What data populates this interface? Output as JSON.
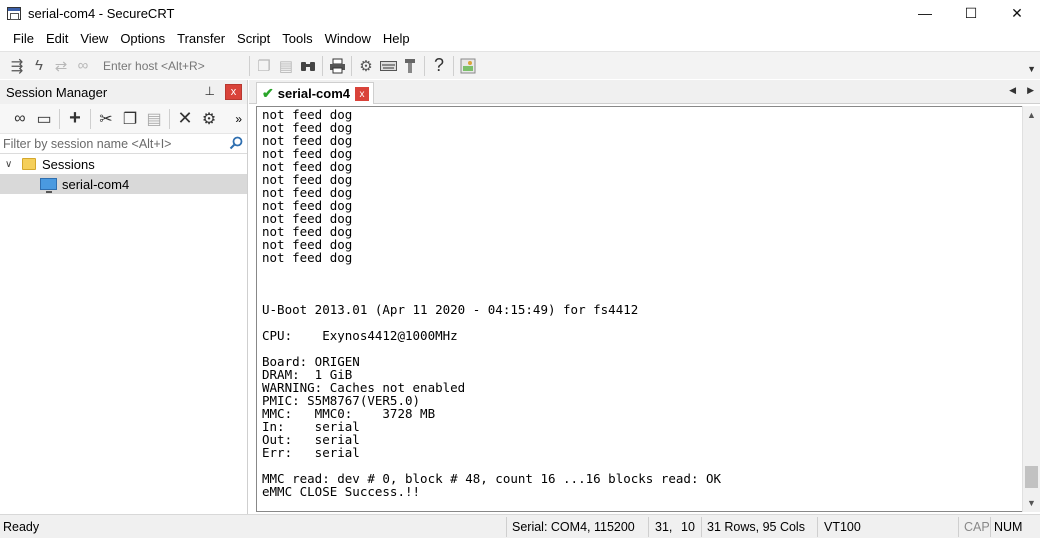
{
  "window": {
    "title": "serial-com4 - SecureCRT",
    "minimize": "—",
    "maximize": "☐",
    "close": "✕"
  },
  "menu": [
    "File",
    "Edit",
    "View",
    "Options",
    "Transfer",
    "Script",
    "Tools",
    "Window",
    "Help"
  ],
  "toolbar": {
    "quick_connect_placeholder": "Enter host <Alt+R>",
    "icons": [
      "connect-tree-icon",
      "lightning-icon",
      "reconnect-icon",
      "link-icon",
      "copy-icon",
      "paste-icon",
      "find-icon",
      "print-icon",
      "settings-icon",
      "keymap-icon",
      "sftp-icon",
      "help-icon",
      "snapshot-icon"
    ]
  },
  "session_manager": {
    "title": "Session Manager",
    "pin": "⊥",
    "close": "x",
    "filter_placeholder": "Filter by session name <Alt+I>",
    "more": "»",
    "tree": {
      "folder": "Sessions",
      "item": "serial-com4"
    }
  },
  "tab": {
    "label": "serial-com4",
    "close": "x"
  },
  "terminal": {
    "lines": [
      "not feed dog",
      "not feed dog",
      "not feed dog",
      "not feed dog",
      "not feed dog",
      "not feed dog",
      "not feed dog",
      "not feed dog",
      "not feed dog",
      "not feed dog",
      "not feed dog",
      "not feed dog",
      "",
      "",
      "",
      "U-Boot 2013.01 (Apr 11 2020 - 04:15:49) for fs4412",
      "",
      "CPU:    Exynos4412@1000MHz",
      "",
      "Board: ORIGEN",
      "DRAM:  1 GiB",
      "WARNING: Caches not enabled",
      "PMIC: S5M8767(VER5.0)",
      "MMC:   MMC0:    3728 MB",
      "In:    serial",
      "Out:   serial",
      "Err:   serial",
      "",
      "MMC read: dev # 0, block # 48, count 16 ...16 blocks read: OK",
      "eMMC CLOSE Success.!!"
    ]
  },
  "status": {
    "ready": "Ready",
    "connection": "Serial: COM4, 115200",
    "row": "31,",
    "col": "10",
    "size": "31 Rows, 95 Cols",
    "emulation": "VT100",
    "cap": "CAP",
    "num": "NUM"
  }
}
